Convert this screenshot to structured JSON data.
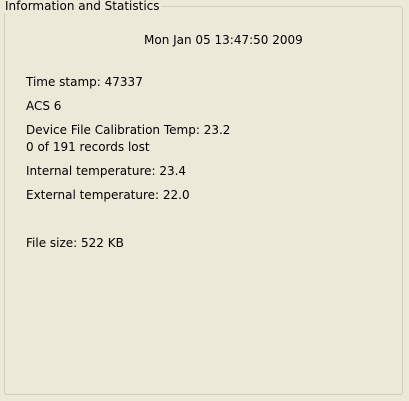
{
  "group": {
    "title": "Information and Statistics"
  },
  "info": {
    "datetime": "Mon Jan 05 13:47:50 2009",
    "lines": [
      "Time stamp: 47337",
      "ACS 6",
      "Device File Calibration Temp: 23.2",
      "0 of 191 records lost",
      "Internal temperature: 23.4",
      "External temperature: 22.0",
      "File size: 522 KB"
    ]
  }
}
